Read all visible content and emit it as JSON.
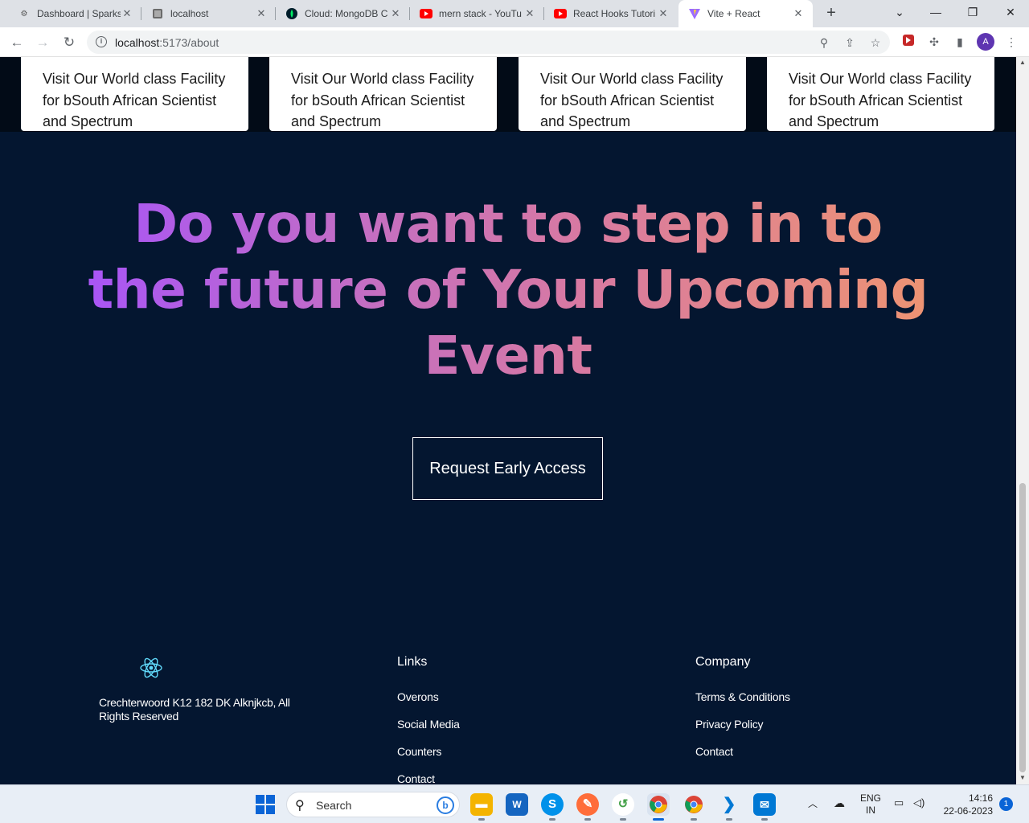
{
  "browser": {
    "tabs": [
      {
        "title": "Dashboard | Sparks",
        "icon": "sparks-icon",
        "active": false
      },
      {
        "title": "localhost",
        "icon": "localhost-icon",
        "active": false
      },
      {
        "title": "Cloud: MongoDB C",
        "icon": "mongodb-icon",
        "active": false
      },
      {
        "title": "mern stack - YouTu",
        "icon": "youtube-icon",
        "active": false
      },
      {
        "title": "React Hooks Tutori",
        "icon": "youtube-icon",
        "active": false
      },
      {
        "title": "Vite + React",
        "icon": "vite-icon",
        "active": true
      }
    ],
    "url_host": "localhost",
    "url_path": ":5173/about",
    "profile_initial": "A"
  },
  "page": {
    "cards": [
      {
        "text": "Visit Our World class Facility for bSouth African Scientist and Spectrum"
      },
      {
        "text": "Visit Our World class Facility for bSouth African Scientist and Spectrum"
      },
      {
        "text": "Visit Our World class Facility for bSouth African Scientist and Spectrum"
      },
      {
        "text": "Visit Our World class Facility for bSouth African Scientist and Spectrum"
      }
    ],
    "hero_title": "Do you want to step in to the future of Your Upcoming Event",
    "cta_label": "Request Early Access",
    "footer": {
      "address": "Crechterwoord K12 182 DK Alknjkcb, All Rights Reserved",
      "links_heading": "Links",
      "links": [
        "Overons",
        "Social Media",
        "Counters",
        "Contact"
      ],
      "company_heading": "Company",
      "company_links": [
        "Terms & Conditions",
        "Privacy Policy",
        "Contact"
      ]
    },
    "colors": {
      "background": "#041630",
      "gradient_start": "#a855f7",
      "gradient_end": "#ee9472"
    }
  },
  "taskbar": {
    "search_label": "Search",
    "language": "ENG",
    "region": "IN",
    "time": "14:16",
    "date": "22-06-2023",
    "notification_count": "1"
  }
}
